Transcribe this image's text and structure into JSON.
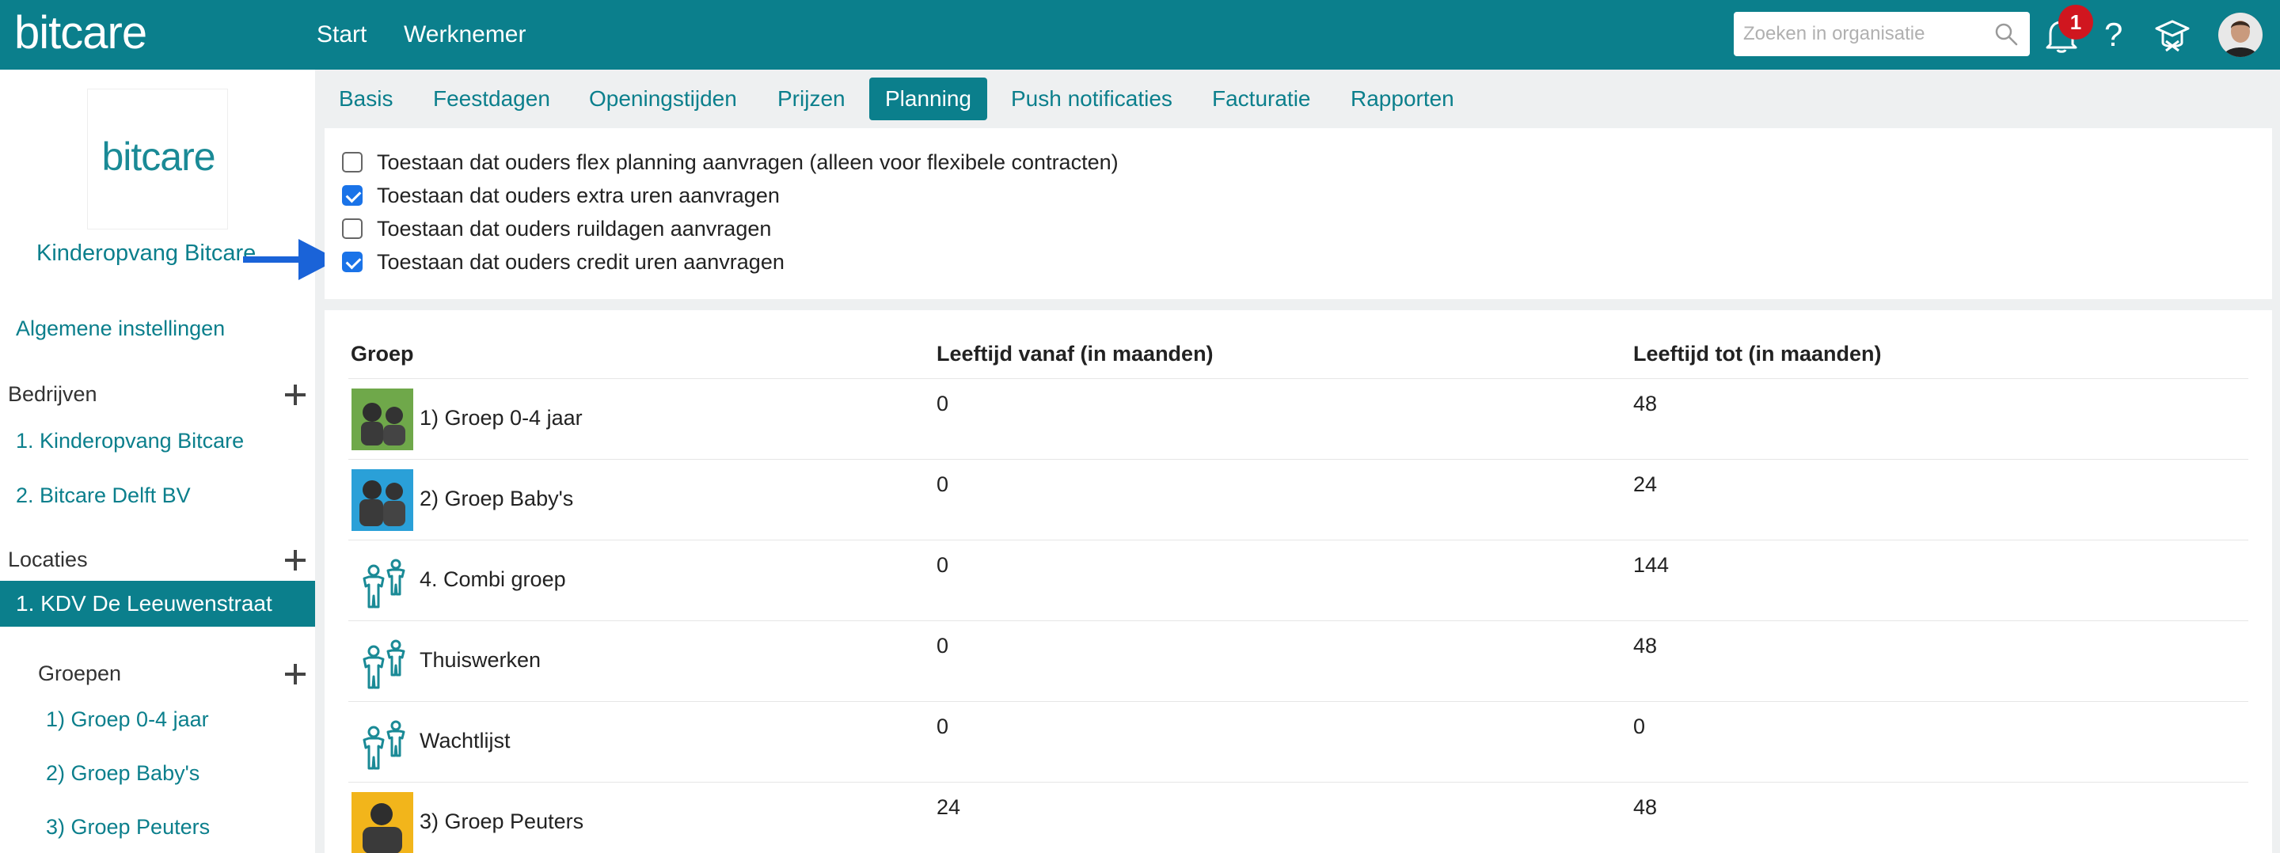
{
  "app": {
    "logo": "bitcare",
    "nav": [
      "Start",
      "Werknemer"
    ],
    "search_placeholder": "Zoeken in organisatie",
    "notification_count": "1",
    "help": "?"
  },
  "sidebar": {
    "org_logo": "bitcare",
    "org_name": "Kinderopvang Bitcare",
    "general_settings": "Algemene instellingen",
    "companies_heading": "Bedrijven",
    "companies": [
      "1. Kinderopvang Bitcare",
      "2. Bitcare Delft BV"
    ],
    "locations_heading": "Locaties",
    "active_location": "1. KDV De Leeuwenstraat",
    "groups_heading": "Groepen",
    "groups": [
      "1) Groep 0-4 jaar",
      "2) Groep Baby's",
      "3) Groep Peuters"
    ]
  },
  "tabs": [
    {
      "label": "Basis",
      "active": false
    },
    {
      "label": "Feestdagen",
      "active": false
    },
    {
      "label": "Openingstijden",
      "active": false
    },
    {
      "label": "Prijzen",
      "active": false
    },
    {
      "label": "Planning",
      "active": true
    },
    {
      "label": "Push notificaties",
      "active": false
    },
    {
      "label": "Facturatie",
      "active": false
    },
    {
      "label": "Rapporten",
      "active": false
    }
  ],
  "checkboxes": [
    {
      "label": "Toestaan dat ouders flex planning aanvragen (alleen voor flexibele contracten)",
      "checked": false
    },
    {
      "label": "Toestaan dat ouders extra uren aanvragen",
      "checked": true
    },
    {
      "label": "Toestaan dat ouders ruildagen aanvragen",
      "checked": false
    },
    {
      "label": "Toestaan dat ouders credit uren aanvragen",
      "checked": true
    }
  ],
  "table": {
    "headers": [
      "Groep",
      "Leeftijd vanaf (in maanden)",
      "Leeftijd tot (in maanden)"
    ],
    "rows": [
      {
        "name": "1) Groep 0-4 jaar",
        "from": "0",
        "to": "48",
        "image": "photo-green"
      },
      {
        "name": "2) Groep Baby's",
        "from": "0",
        "to": "24",
        "image": "photo-blue"
      },
      {
        "name": "4. Combi groep",
        "from": "0",
        "to": "144",
        "image": "children-icon"
      },
      {
        "name": "Thuiswerken",
        "from": "0",
        "to": "48",
        "image": "children-icon"
      },
      {
        "name": "Wachtlijst",
        "from": "0",
        "to": "0",
        "image": "children-icon"
      },
      {
        "name": "3) Groep Peuters",
        "from": "24",
        "to": "48",
        "image": "photo-yellow"
      }
    ]
  },
  "colors": {
    "brand": "#0b7f8c",
    "checkbox": "#1a73e8",
    "badge": "#d0161f",
    "arrow": "#1a63d8"
  }
}
